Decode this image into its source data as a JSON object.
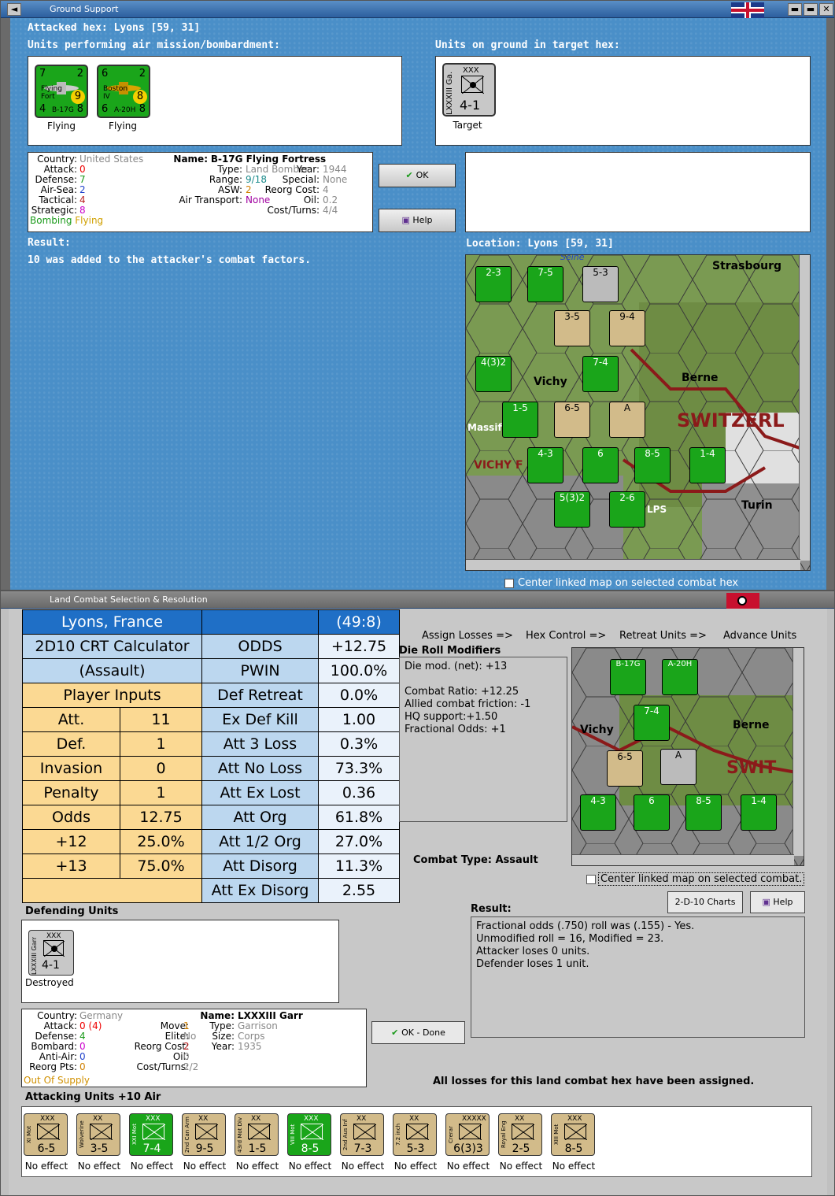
{
  "top_window": {
    "title": "Ground Support",
    "attacked_hex": "Attacked hex: Lyons  [59, 31]",
    "units_performing_label": "Units performing air mission/bombardment:",
    "units_ground_label": "Units on ground in target hex:",
    "air_units": [
      {
        "name_line1": "Flying",
        "name_line2": "Fort",
        "model": "B-17G",
        "left": "7",
        "right": "2",
        "bl": "4",
        "br": "8",
        "badge": "9",
        "status": "Flying"
      },
      {
        "name_line1": "Boston",
        "name_line2": "IV",
        "model": "A-20H",
        "left": "6",
        "right": "2",
        "bl": "6",
        "br": "8",
        "badge": "8",
        "status": "Flying"
      }
    ],
    "ground_unit": {
      "name": "LXXXIII Ga.",
      "size": "XXX",
      "value": "4-1",
      "status": "Target"
    },
    "info": {
      "country_k": "Country:",
      "country_v": "United States",
      "attack_k": "Attack:",
      "attack_v": "0",
      "defense_k": "Defense:",
      "defense_v": "7",
      "airsea_k": "Air-Sea:",
      "airsea_v": "2",
      "tactical_k": "Tactical:",
      "tactical_v": "4",
      "strategic_k": "Strategic:",
      "strategic_v": "8",
      "bombing_k": "Bombing",
      "bombing_v": "Flying",
      "name_k": "Name:",
      "name_v": "B-17G Flying Fortress",
      "type_k": "Type:",
      "type_v": "Land Bomber",
      "year_k": "Year:",
      "year_v": "1944",
      "range_k": "Range:",
      "range_v": "9/18",
      "special_k": "Special:",
      "special_v": "None",
      "asw_k": "ASW:",
      "asw_v": "2",
      "reorg_k": "Reorg Cost:",
      "reorg_v": "4",
      "airtrans_k": "Air Transport:",
      "airtrans_v": "None",
      "oil_k": "Oil:",
      "oil_v": "0.2",
      "cost_k": "Cost/Turns:",
      "cost_v": "4/4"
    },
    "ok_label": "OK",
    "help_label": "Help",
    "result_label": "Result:",
    "result_text": "10 was added to the attacker's combat factors.",
    "location_label": "Location:  Lyons  [59, 31]",
    "map_labels": {
      "strasbourg": "Strasbourg",
      "vichy": "Vichy",
      "berne": "Berne",
      "switzerland": "SWITZERL",
      "vichy_f": "VICHY F",
      "turin": "Turin",
      "massif": "Massif",
      "lps": "LPS",
      "seine": "Seine"
    },
    "center_map_label": "Center linked map on selected combat hex"
  },
  "bottom_window": {
    "title": "Land Combat Selection & Resolution",
    "crt": {
      "location": "Lyons, France",
      "ratio": "(49:8)",
      "calc_line1": "2D10 CRT Calculator",
      "calc_line2": "(Assault)",
      "player_inputs": "Player Inputs",
      "rows_left": [
        {
          "k": "Att.",
          "v": "11"
        },
        {
          "k": "Def.",
          "v": "1"
        },
        {
          "k": "Invasion",
          "v": "0"
        },
        {
          "k": "Penalty",
          "v": "1"
        },
        {
          "k": "Odds",
          "v": "12.75"
        },
        {
          "k": "+12",
          "v": "25.0%"
        },
        {
          "k": "+13",
          "v": "75.0%"
        }
      ],
      "rows_right": [
        {
          "k": "ODDS",
          "v": "+12.75"
        },
        {
          "k": "PWIN",
          "v": "100.0%"
        },
        {
          "k": "Def Retreat",
          "v": "0.0%"
        },
        {
          "k": "Ex Def Kill",
          "v": "1.00"
        },
        {
          "k": "Att 3 Loss",
          "v": "0.3%"
        },
        {
          "k": "Att No Loss",
          "v": "73.3%"
        },
        {
          "k": "Att Ex Lost",
          "v": "0.36"
        },
        {
          "k": "Att Org",
          "v": "61.8%"
        },
        {
          "k": "Att 1/2 Org",
          "v": "27.0%"
        },
        {
          "k": "Att Disorg",
          "v": "11.3%"
        },
        {
          "k": "Att Ex Disorg",
          "v": "2.55"
        }
      ]
    },
    "tabs": [
      "Assign Losses =>",
      "Hex Control =>",
      "Retreat Units =>",
      "Advance Units"
    ],
    "die_roll_label": "Die Roll Modifiers",
    "die_roll_lines": [
      "Die mod. (net): +13",
      "",
      "Combat Ratio: +12.25",
      "Allied combat friction: -1",
      "HQ support:+1.50",
      "Fractional Odds: +1"
    ],
    "combat_type": "Combat Type:  Assault",
    "center_map_label": "Center linked map on selected combat.",
    "charts_label": "2-D-10 Charts",
    "help_label": "Help",
    "result_label": "Result:",
    "result_lines": [
      "Fractional odds (.750) roll was (.155)  - Yes.",
      "Unmodified roll = 16, Modified = 23.",
      "Attacker loses 0 units.",
      "Defender loses 1 unit."
    ],
    "defending_label": "Defending Units",
    "def_unit": {
      "name": "LXXXIII Garr",
      "size": "XXX",
      "value": "4-1",
      "status": "Destroyed"
    },
    "info": {
      "country_k": "Country:",
      "country_v": "Germany",
      "attack_k": "Attack:",
      "attack_v": "0 (4)",
      "defense_k": "Defense:",
      "defense_v": "4",
      "bombard_k": "Bombard:",
      "bombard_v": "0",
      "antiair_k": "Anti-Air:",
      "antiair_v": "0",
      "reorgpts_k": "Reorg Pts:",
      "reorgpts_v": "0",
      "supply": "Out Of Supply",
      "move_k": "Move:",
      "move_v": "1",
      "elite_k": "Elite:",
      "elite_v": "No",
      "reorg_k": "Reorg Cost:",
      "reorg_v": "2",
      "oil_k": "Oil:",
      "oil_v": "0",
      "cost_k": "Cost/Turns:",
      "cost_v": "2/2",
      "name_k": "Name:",
      "name_v": "LXXXIII Garr",
      "type_k": "Type:",
      "type_v": "Garrison",
      "size_k": "Size:",
      "size_v": "Corps",
      "year_k": "Year:",
      "year_v": "1935"
    },
    "ok_done_label": "OK - Done",
    "all_losses": "All losses for this land combat hex have been assigned.",
    "attacking_label": "Attacking Units +10 Air",
    "attack_units": [
      {
        "name": "XI Mot",
        "size": "XXX",
        "value": "6-5",
        "green": false,
        "status": "No effect"
      },
      {
        "name": "Wolverine",
        "size": "XX",
        "value": "3-5",
        "green": false,
        "status": "No effect"
      },
      {
        "name": "XXI Mot",
        "size": "XXX",
        "value": "7-4",
        "green": true,
        "status": "No effect"
      },
      {
        "name": "2nd Can Arm",
        "size": "XX",
        "value": "9-5",
        "green": false,
        "status": "No effect"
      },
      {
        "name": "43rd Mot Div",
        "size": "XX",
        "value": "1-5",
        "green": false,
        "status": "No effect"
      },
      {
        "name": "VIII Mot",
        "size": "XXX",
        "value": "8-5",
        "green": true,
        "status": "No effect"
      },
      {
        "name": "2nd Aus Inf",
        "size": "XX",
        "value": "7-3",
        "green": false,
        "status": "No effect"
      },
      {
        "name": "7.2 inch",
        "size": "XX",
        "value": "5-3",
        "green": false,
        "status": "No effect"
      },
      {
        "name": "Crerar",
        "size": "XXXXX",
        "value": "6(3)3",
        "green": false,
        "status": "No effect"
      },
      {
        "name": "Royal Eng",
        "size": "XX",
        "value": "2-5",
        "green": false,
        "status": "No effect"
      },
      {
        "name": "XIII Mot",
        "size": "XXX",
        "value": "8-5",
        "green": false,
        "status": "No effect"
      }
    ]
  }
}
